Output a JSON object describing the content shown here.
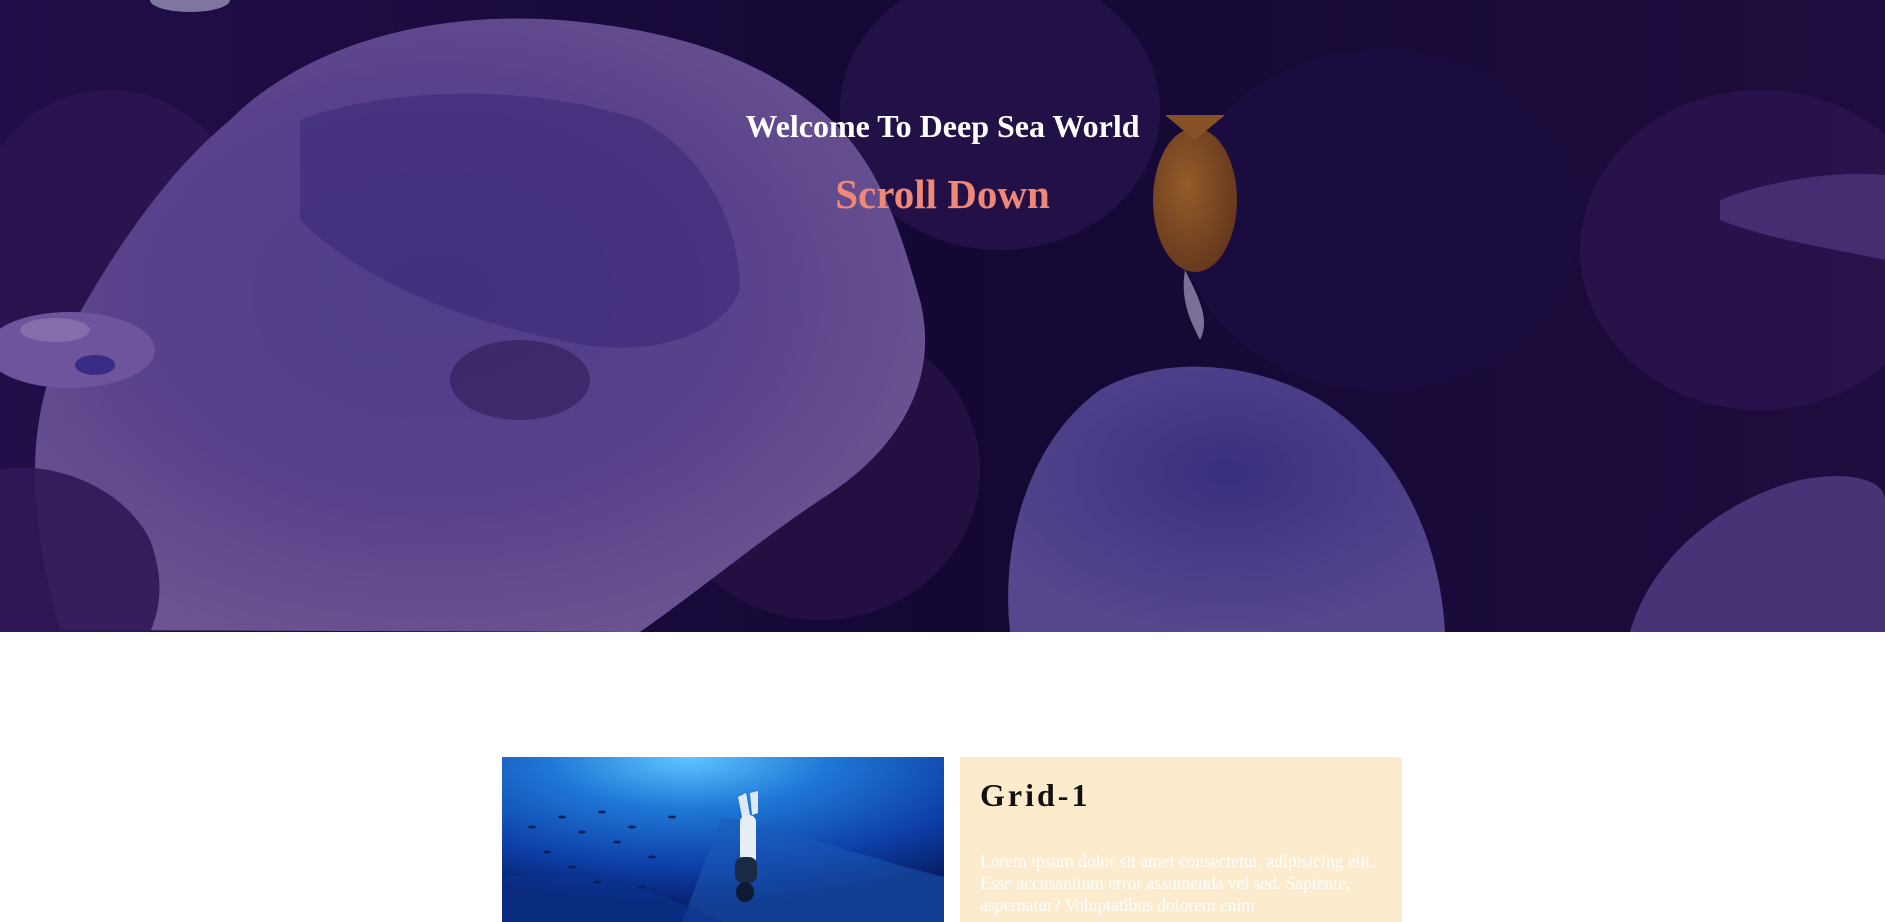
{
  "hero": {
    "title": "Welcome To Deep Sea World",
    "scroll_label": "Scroll Down",
    "scroll_color": "#f08878",
    "title_color": "#ffffff",
    "background_tint": "#140a3c"
  },
  "grid": {
    "card_title": "Grid-1",
    "card_text": "Lorem ipsum dolor sit amet consectetur, adipisicing elit. Esse accusantium error assumenda vel sed. Sapiente, aspernatur? Voluptatibus dolorem enim",
    "card_background": "#fdebcd"
  }
}
